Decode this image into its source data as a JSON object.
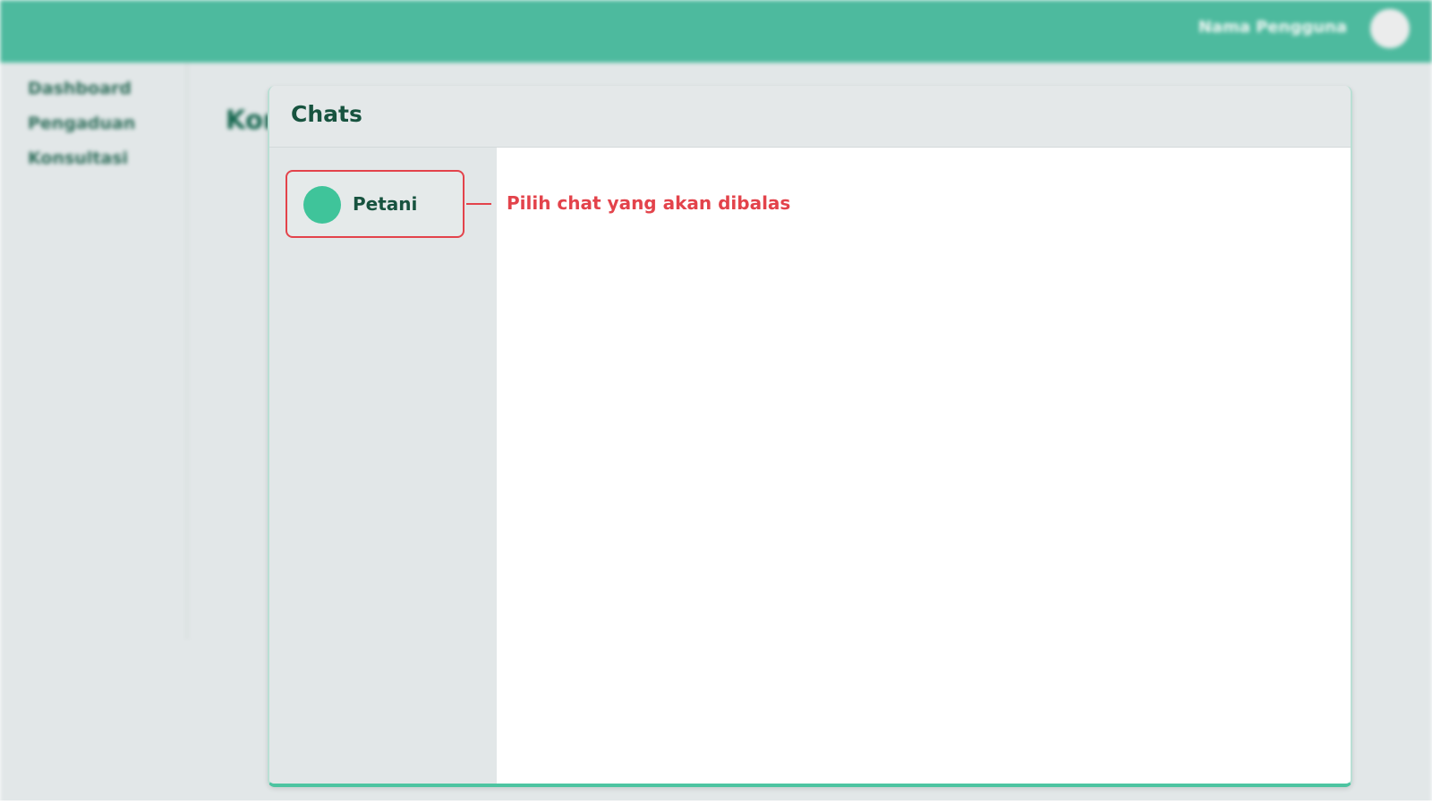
{
  "topbar": {
    "user_name": "Nama Pengguna"
  },
  "sidebar": {
    "items": [
      {
        "label": "Dashboard"
      },
      {
        "label": "Pengaduan"
      },
      {
        "label": "Konsultasi"
      }
    ]
  },
  "main": {
    "page_title_partial": "Kor"
  },
  "chat_panel": {
    "title": "Chats",
    "chats": [
      {
        "name": "Petani"
      }
    ],
    "annotation": "Pilih chat yang akan dibalas"
  },
  "colors": {
    "primary": "#4dba9e",
    "avatar_accent": "#3fc49a",
    "annotation_red": "#e3434b",
    "dark_green_text": "#17533f"
  }
}
